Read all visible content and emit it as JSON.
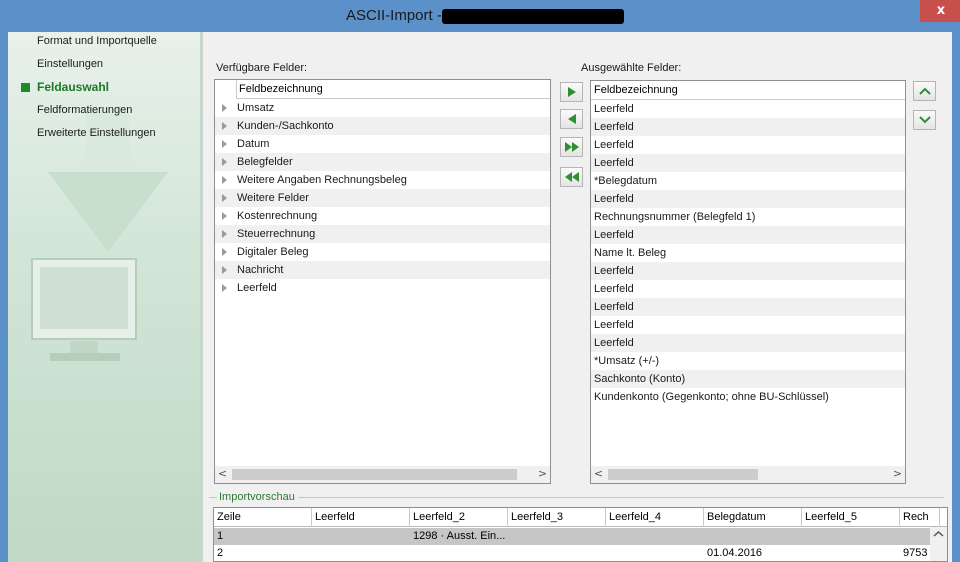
{
  "window": {
    "title": "ASCII-Import -",
    "close_label": "x"
  },
  "sidebar": {
    "items": [
      {
        "label": "Format und Importquelle",
        "active": false
      },
      {
        "label": "Einstellungen",
        "active": false
      },
      {
        "label": "Feldauswahl",
        "active": true
      },
      {
        "label": "Feldformatierungen",
        "active": false
      },
      {
        "label": "Erweiterte Einstellungen",
        "active": false
      }
    ]
  },
  "available": {
    "label": "Verfügbare Felder:",
    "header": "Feldbezeichnung",
    "items": [
      "Umsatz",
      "Kunden-/Sachkonto",
      "Datum",
      "Belegfelder",
      "Weitere Angaben Rechnungsbeleg",
      "Weitere Felder",
      "Kostenrechnung",
      "Steuerrechnung",
      "Digitaler Beleg",
      "Nachricht",
      "Leerfeld"
    ]
  },
  "selected": {
    "label": "Ausgewählte Felder:",
    "header": "Feldbezeichnung",
    "items": [
      "Leerfeld",
      "Leerfeld",
      "Leerfeld",
      "Leerfeld",
      "*Belegdatum",
      "Leerfeld",
      "Rechnungsnummer (Belegfeld 1)",
      "Leerfeld",
      "Name lt. Beleg",
      "Leerfeld",
      "Leerfeld",
      "Leerfeld",
      "Leerfeld",
      "Leerfeld",
      "*Umsatz (+/-)",
      "Sachkonto (Konto)",
      "Kundenkonto (Gegenkonto; ohne BU-Schlüssel)"
    ]
  },
  "scroll": {
    "left_arrow": "<",
    "right_arrow": ">"
  },
  "preview": {
    "label": "Importvorschau",
    "columns": [
      "Zeile",
      "Leerfeld",
      "Leerfeld_2",
      "Leerfeld_3",
      "Leerfeld_4",
      "Belegdatum",
      "Leerfeld_5",
      "Rech"
    ],
    "rows": [
      [
        "1",
        "",
        "1298 · Ausst. Ein...",
        "",
        "",
        "",
        "",
        ""
      ],
      [
        "2",
        "",
        "",
        "",
        "",
        "01.04.2016",
        "",
        "9753"
      ]
    ]
  },
  "colors": {
    "titlebar": "#5b90c9",
    "active_nav": "#1a7a25",
    "close": "#c7504c"
  }
}
